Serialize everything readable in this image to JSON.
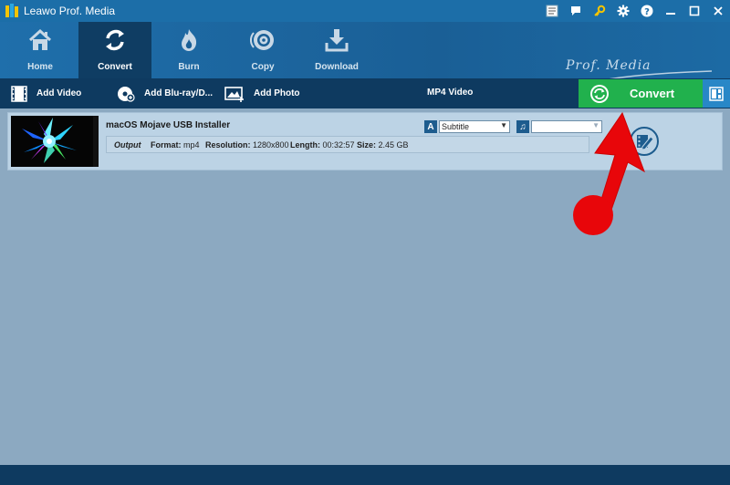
{
  "window": {
    "title": "Leawo Prof. Media",
    "brand": "Prof. Media"
  },
  "nav": {
    "items": [
      {
        "id": "home",
        "label": "Home",
        "icon": "home-icon"
      },
      {
        "id": "convert",
        "label": "Convert",
        "icon": "convert-icon",
        "active": true
      },
      {
        "id": "burn",
        "label": "Burn",
        "icon": "burn-icon"
      },
      {
        "id": "copy",
        "label": "Copy",
        "icon": "disc-copy-icon"
      },
      {
        "id": "download",
        "label": "Download",
        "icon": "download-icon"
      }
    ]
  },
  "toolbar": {
    "add_video": "Add Video",
    "add_bluray": "Add Blu-ray/D...",
    "add_photo": "Add Photo",
    "format": "MP4 Video",
    "convert": "Convert"
  },
  "item": {
    "title": "macOS Mojave USB Installer",
    "output_label": "Output",
    "format_label": "Format:",
    "format_value": "mp4",
    "resolution_label": "Resolution:",
    "resolution_value": "1280x800",
    "length_label": "Length:",
    "length_value": "00:32:57",
    "size_label": "Size:",
    "size_value": "2.45 GB",
    "subtitle_select": "Subtitle",
    "audio_select": ""
  },
  "colors": {
    "titlebar": "#1c6ea8",
    "toolbar": "#0e3a60",
    "convert_green": "#21b14d",
    "content_bg": "#8ca9c1",
    "arrow_red": "#e8060a"
  }
}
